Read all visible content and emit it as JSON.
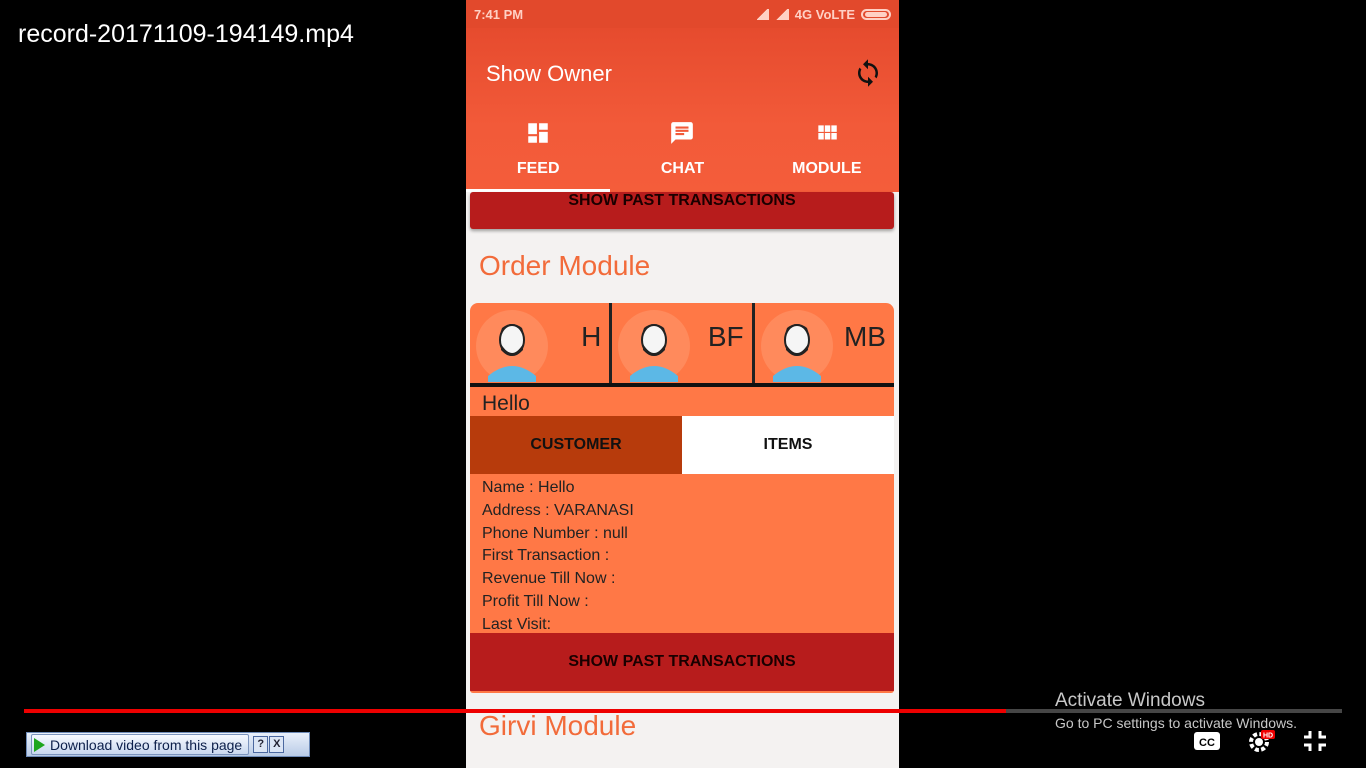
{
  "video": {
    "title": "record-20171109-194149.mp4",
    "progress_fraction": 0.745
  },
  "statusbar": {
    "time": "7:41 PM",
    "network": "4G VoLTE"
  },
  "appbar": {
    "title": "Show Owner"
  },
  "tabs": [
    {
      "label": "FEED",
      "icon": "dashboard-icon"
    },
    {
      "label": "CHAT",
      "icon": "chat-icon"
    },
    {
      "label": "MODULE",
      "icon": "apps-grid-icon"
    }
  ],
  "feed": {
    "past_transactions_label": "SHOW PAST TRANSACTIONS",
    "order_module": {
      "title": "Order Module",
      "persons": [
        {
          "initial": "H"
        },
        {
          "initial": "BF"
        },
        {
          "initial": "MB"
        }
      ],
      "customer_name": "Hello",
      "subtabs": [
        "CUSTOMER",
        "ITEMS"
      ],
      "details": [
        "Name : Hello",
        "Address : VARANASI",
        "Phone Number : null",
        "First Transaction :",
        "Revenue Till Now :",
        "Profit Till Now :",
        "Last Visit:"
      ],
      "past_transactions_label": "SHOW PAST TRANSACTIONS"
    },
    "girvi_module": {
      "title": "Girvi Module"
    }
  },
  "overlay": {
    "activate_title": "Activate Windows",
    "activate_sub": "Go to PC settings to activate Windows.",
    "download_label": "Download video from this page",
    "help_label": "?",
    "close_label": "X"
  },
  "colors": {
    "accent": "#f45d3a",
    "card": "#ff7846",
    "button": "#b71c1c",
    "progress": "#e00000"
  }
}
